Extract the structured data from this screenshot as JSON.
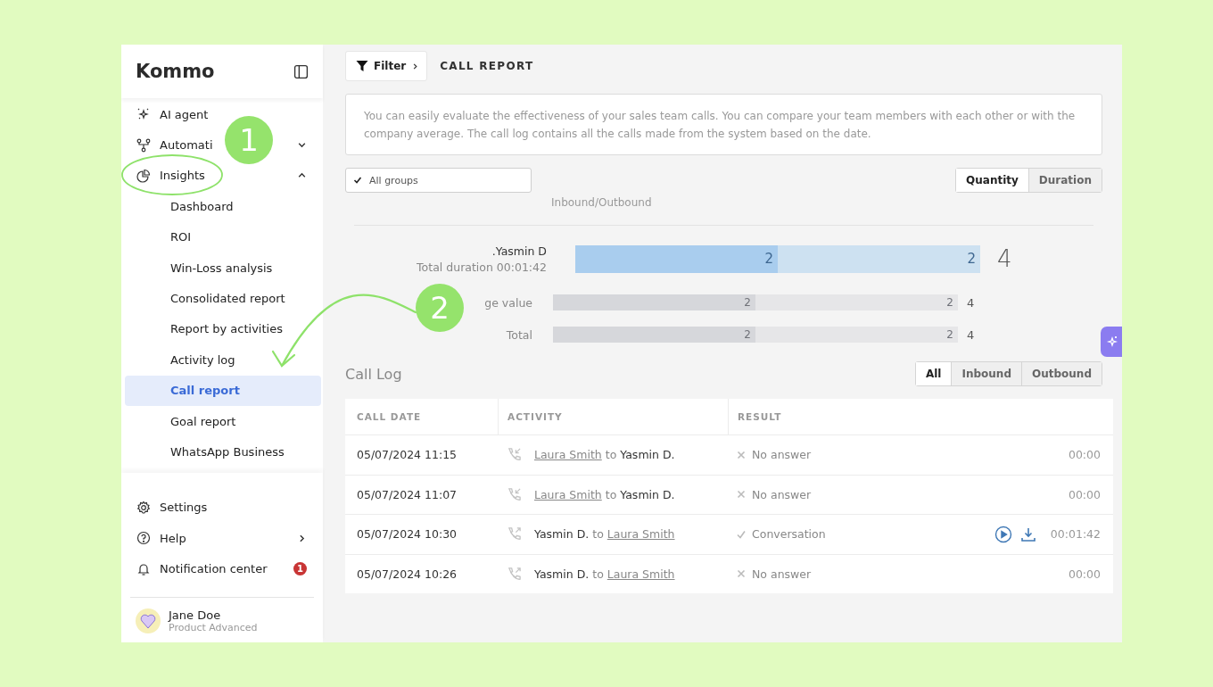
{
  "sidebar": {
    "logo": "Kommo",
    "nav": [
      {
        "kind": "link",
        "label": "AI agent"
      },
      {
        "kind": "group",
        "label": "Automati",
        "expanded": false
      },
      {
        "kind": "group",
        "label": "Insights",
        "expanded": true,
        "children": [
          {
            "label": "Dashboard",
            "selected": false
          },
          {
            "label": "ROI",
            "selected": false
          },
          {
            "label": "Win-Loss analysis",
            "selected": false
          },
          {
            "label": "Consolidated report",
            "selected": false
          },
          {
            "label": "Report by activities",
            "selected": false
          },
          {
            "label": "Activity log",
            "selected": false
          },
          {
            "label": "Call report",
            "selected": true
          },
          {
            "label": "Goal report",
            "selected": false
          },
          {
            "label": "WhatsApp Business",
            "selected": false
          }
        ]
      }
    ],
    "bottom": [
      {
        "kind": "link",
        "label": "Settings"
      },
      {
        "kind": "submenu",
        "label": "Help"
      },
      {
        "kind": "link",
        "label": "Notification center",
        "badge": "1"
      }
    ],
    "user": {
      "name": "Jane Doe",
      "plan": "Product Advanced"
    }
  },
  "toolbar": {
    "filter": "Filter",
    "title": "CALL REPORT"
  },
  "description": "You can easily evaluate the effectiveness of your sales team calls. You can compare your team members with each other or with the company average. The call log contains all the calls made from the system based on the date.",
  "group_select": {
    "label": "All groups",
    "checked": true
  },
  "view_toggle": [
    {
      "label": "Quantity",
      "selected": true
    },
    {
      "label": "Duration",
      "selected": false
    }
  ],
  "stats": {
    "header": "Inbound/Outbound",
    "rows": [
      {
        "kind": "user",
        "label": ".Yasmin D",
        "sublabel": "Total duration 00:01:42",
        "level": 0.5,
        "inbound": "2",
        "outbound": "2",
        "total": "4"
      },
      {
        "kind": "summary",
        "label": "ge value",
        "level": 0.5,
        "inbound": "2",
        "outbound": "2",
        "total": "4"
      },
      {
        "kind": "summary",
        "label": "Total",
        "level": 0.5,
        "inbound": "2",
        "outbound": "2",
        "total": "4"
      }
    ]
  },
  "call_log": {
    "title": "Call Log",
    "filters": [
      {
        "label": "All",
        "selected": true
      },
      {
        "label": "Inbound",
        "selected": false
      },
      {
        "label": "Outbound",
        "selected": false
      }
    ],
    "columns": [
      "CALL DATE",
      "ACTIVITY",
      "RESULT"
    ],
    "rows": [
      {
        "kind": "inbound",
        "date": "05/07/2024 11:15",
        "from": {
          "name": "Laura Smith",
          "link": true
        },
        "connector": "to",
        "to": {
          "name": "Yasmin D.",
          "link": false
        },
        "answered": false,
        "result": "No answer",
        "recording": false,
        "duration": "00:00"
      },
      {
        "kind": "inbound",
        "date": "05/07/2024 11:07",
        "from": {
          "name": "Laura Smith",
          "link": true
        },
        "connector": "to",
        "to": {
          "name": "Yasmin D.",
          "link": false
        },
        "answered": false,
        "result": "No answer",
        "recording": false,
        "duration": "00:00"
      },
      {
        "kind": "outbound",
        "date": "05/07/2024 10:30",
        "from": {
          "name": "Yasmin D.",
          "link": false
        },
        "connector": "to",
        "to": {
          "name": "Laura Smith",
          "link": true
        },
        "answered": true,
        "result": "Conversation",
        "recording": true,
        "duration": "00:01:42"
      },
      {
        "kind": "outbound",
        "date": "05/07/2024 10:26",
        "from": {
          "name": "Yasmin D.",
          "link": false
        },
        "connector": "to",
        "to": {
          "name": "Laura Smith",
          "link": true
        },
        "answered": false,
        "result": "No answer",
        "recording": false,
        "duration": "00:00"
      }
    ]
  },
  "annotations": [
    {
      "kind": "step",
      "label": "1"
    },
    {
      "kind": "step",
      "label": "2"
    }
  ]
}
